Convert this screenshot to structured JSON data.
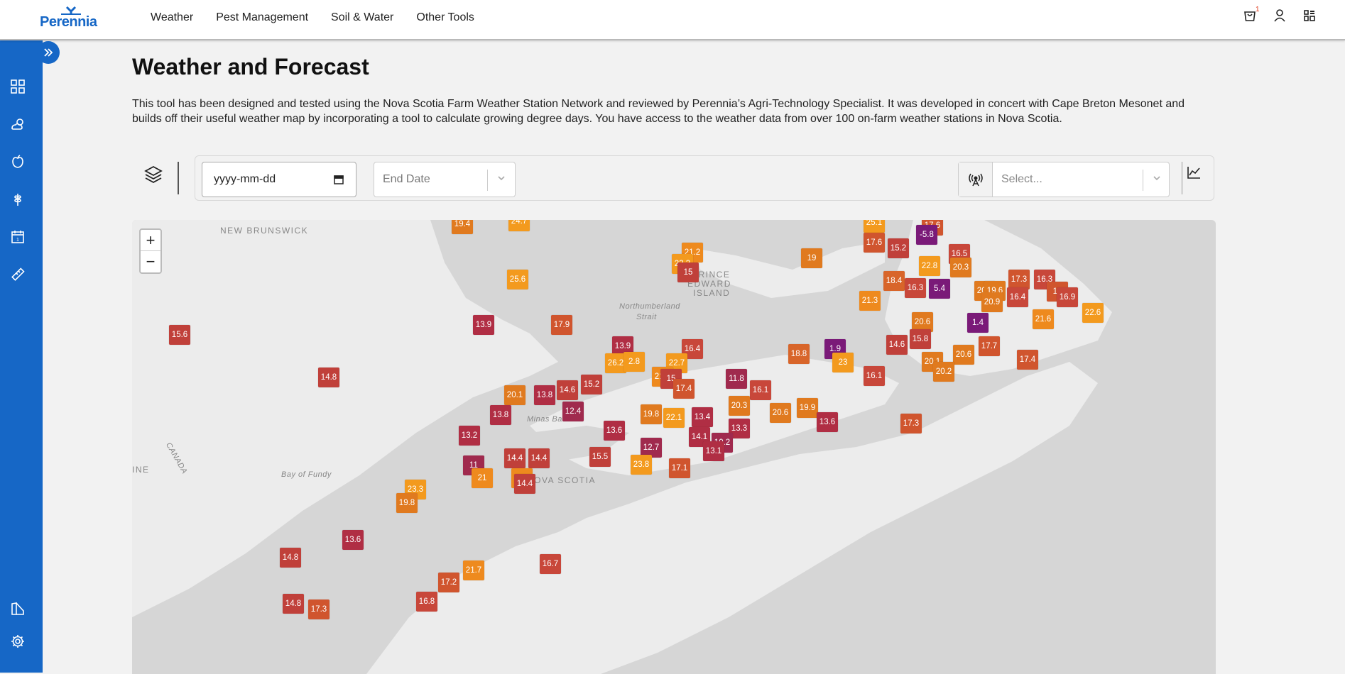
{
  "brand": {
    "name": "Perennia",
    "accent": "#1667c6"
  },
  "nav": [
    "Weather",
    "Pest Management",
    "Soil & Water",
    "Other Tools"
  ],
  "header_icons": {
    "cart_count": "1",
    "cart": "cart-icon",
    "user": "user-icon",
    "apps": "apps-icon"
  },
  "sidebar": {
    "icons": [
      "dashboard-icon",
      "weather-icon",
      "apple-icon",
      "wheat-icon",
      "calendar-icon",
      "ruler-icon",
      "map-legend-icon",
      "gear-icon"
    ]
  },
  "page": {
    "title": "Weather and Forecast",
    "description": "This tool has been designed and tested using the Nova Scotia Farm Weather Station Network and reviewed by Perennia’s Agri-Technology Specialist. It was developed in concert with Cape Breton Mesonet and builds off their useful weather map by incorporating a tool to calculate growing degree days. You have access to the weather data from over 100 on-farm weather stations in Nova Scotia."
  },
  "controls": {
    "start_date_placeholder": "yyyy-mm-dd",
    "end_date_placeholder": "End Date",
    "station_placeholder": "Select..."
  },
  "map": {
    "zoom_in": "+",
    "zoom_out": "−",
    "places": [
      {
        "name": "NEW BRUNSWICK",
        "cls": ""
      },
      {
        "name": "PRINCE",
        "cls": ""
      },
      {
        "name": "EDWARD",
        "cls": ""
      },
      {
        "name": "ISLAND",
        "cls": ""
      },
      {
        "name": "Northumberland",
        "cls": "it"
      },
      {
        "name": "Strait",
        "cls": "it"
      },
      {
        "name": "Minas Basin",
        "cls": "it"
      },
      {
        "name": "Bay of Fundy",
        "cls": "it"
      },
      {
        "name": "NOVA SCOTIA",
        "cls": ""
      },
      {
        "name": "INE",
        "cls": ""
      },
      {
        "name": "CANADA",
        "cls": "it"
      }
    ],
    "markers": [
      {
        "v": "19.4",
        "c": "#e07a1f"
      },
      {
        "v": "24.7",
        "c": "#f39a1e"
      },
      {
        "v": "25.1",
        "c": "#f39a1e"
      },
      {
        "v": "17.6",
        "c": "#d0552e"
      },
      {
        "v": "-5.8",
        "c": "#7a1a78"
      },
      {
        "v": "17.6",
        "c": "#d0552e"
      },
      {
        "v": "15.2",
        "c": "#c0403a"
      },
      {
        "v": "21.2",
        "c": "#ee8a1e"
      },
      {
        "v": "23.3",
        "c": "#f39a1e"
      },
      {
        "v": "19",
        "c": "#e07a1f"
      },
      {
        "v": "16.5",
        "c": "#c8473a"
      },
      {
        "v": "22.8",
        "c": "#f39a1e"
      },
      {
        "v": "20.3",
        "c": "#e07a1f"
      },
      {
        "v": "15",
        "c": "#c0403a"
      },
      {
        "v": "25.6",
        "c": "#f39a1e"
      },
      {
        "v": "18.4",
        "c": "#d8652a"
      },
      {
        "v": "16.3",
        "c": "#c8473a"
      },
      {
        "v": "5.4",
        "c": "#7a1a78"
      },
      {
        "v": "20.8",
        "c": "#e07a1f"
      },
      {
        "v": "19.6",
        "c": "#e07a1f"
      },
      {
        "v": "17.3",
        "c": "#d0552e"
      },
      {
        "v": "16.3",
        "c": "#c8473a"
      },
      {
        "v": "17",
        "c": "#d0552e"
      },
      {
        "v": "21.3",
        "c": "#ee8a1e"
      },
      {
        "v": "20.9",
        "c": "#e07a1f"
      },
      {
        "v": "16.4",
        "c": "#c8473a"
      },
      {
        "v": "16.9",
        "c": "#c8473a"
      },
      {
        "v": "13.9",
        "c": "#b02e44"
      },
      {
        "v": "17.9",
        "c": "#d0552e"
      },
      {
        "v": "15.6",
        "c": "#c0403a"
      },
      {
        "v": "20.6",
        "c": "#e07a1f"
      },
      {
        "v": "1.4",
        "c": "#7a1a78"
      },
      {
        "v": "21.6",
        "c": "#ee8a1e"
      },
      {
        "v": "22.6",
        "c": "#f39a1e"
      },
      {
        "v": "15.8",
        "c": "#c0403a"
      },
      {
        "v": "14.6",
        "c": "#c0403a"
      },
      {
        "v": "13.9",
        "c": "#b02e44"
      },
      {
        "v": "16.4",
        "c": "#c8473a"
      },
      {
        "v": "17.7",
        "c": "#d0552e"
      },
      {
        "v": "18.8",
        "c": "#d8652a"
      },
      {
        "v": "1.9",
        "c": "#7a1a78"
      },
      {
        "v": "23",
        "c": "#f39a1e"
      },
      {
        "v": "20.6",
        "c": "#e07a1f"
      },
      {
        "v": "20.1",
        "c": "#e07a1f"
      },
      {
        "v": "17.4",
        "c": "#d0552e"
      },
      {
        "v": "20.2",
        "c": "#e07a1f"
      },
      {
        "v": "26.2",
        "c": "#f39a1e"
      },
      {
        "v": "2.8",
        "c": "#f39a1e"
      },
      {
        "v": "22.7",
        "c": "#f39a1e"
      },
      {
        "v": "14.8",
        "c": "#c0403a"
      },
      {
        "v": "21.2",
        "c": "#ee8a1e"
      },
      {
        "v": "15",
        "c": "#c0403a"
      },
      {
        "v": "11.8",
        "c": "#a02a4e"
      },
      {
        "v": "17.4",
        "c": "#d0552e"
      },
      {
        "v": "16.1",
        "c": "#c8473a"
      },
      {
        "v": "16.1",
        "c": "#c8473a"
      },
      {
        "v": "15.2",
        "c": "#c0403a"
      },
      {
        "v": "14.6",
        "c": "#c0403a"
      },
      {
        "v": "20.1",
        "c": "#e07a1f"
      },
      {
        "v": "13.8",
        "c": "#b02e44"
      },
      {
        "v": "12.4",
        "c": "#a02a4e"
      },
      {
        "v": "20.3",
        "c": "#e07a1f"
      },
      {
        "v": "20.6",
        "c": "#e07a1f"
      },
      {
        "v": "19.9",
        "c": "#e07a1f"
      },
      {
        "v": "13.6",
        "c": "#b02e44"
      },
      {
        "v": "17.3",
        "c": "#d0552e"
      },
      {
        "v": "13.8",
        "c": "#b02e44"
      },
      {
        "v": "13.2",
        "c": "#b02e44"
      },
      {
        "v": "19.8",
        "c": "#e07a1f"
      },
      {
        "v": "22.1",
        "c": "#f39a1e"
      },
      {
        "v": "13.4",
        "c": "#b02e44"
      },
      {
        "v": "13.6",
        "c": "#b02e44"
      },
      {
        "v": "14.1",
        "c": "#b02e44"
      },
      {
        "v": "13.3",
        "c": "#b02e44"
      },
      {
        "v": "10.2",
        "c": "#a02a4e"
      },
      {
        "v": "12.7",
        "c": "#a02a4e"
      },
      {
        "v": "13.1",
        "c": "#b02e44"
      },
      {
        "v": "15.5",
        "c": "#c0403a"
      },
      {
        "v": "23.8",
        "c": "#f39a1e"
      },
      {
        "v": "17.1",
        "c": "#d0552e"
      },
      {
        "v": "14.4",
        "c": "#c0403a"
      },
      {
        "v": "14.4",
        "c": "#c0403a"
      },
      {
        "v": "11",
        "c": "#a02a4e"
      },
      {
        "v": "21",
        "c": "#ee8a1e"
      },
      {
        "v": "21",
        "c": "#ee8a1e"
      },
      {
        "v": "23.3",
        "c": "#f39a1e"
      },
      {
        "v": "19.8",
        "c": "#e07a1f"
      },
      {
        "v": "14.4",
        "c": "#c0403a"
      },
      {
        "v": "14.8",
        "c": "#c0403a"
      },
      {
        "v": "13.6",
        "c": "#b02e44"
      },
      {
        "v": "21.7",
        "c": "#ee8a1e"
      },
      {
        "v": "16.7",
        "c": "#c8473a"
      },
      {
        "v": "17.2",
        "c": "#d0552e"
      },
      {
        "v": "14.8",
        "c": "#c0403a"
      },
      {
        "v": "17.3",
        "c": "#d0552e"
      },
      {
        "v": "16.8",
        "c": "#c8473a"
      }
    ]
  }
}
